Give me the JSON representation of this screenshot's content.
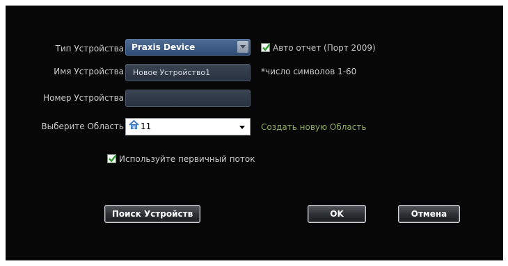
{
  "form": {
    "device_type_label": "Тип Устройства",
    "device_type_value": "Praxis Device",
    "auto_report_label": "Авто отчет (Порт 2009)",
    "auto_report_checked": true,
    "device_name_label": "Имя Устройства",
    "device_name_value": "Новое Устройство1",
    "device_name_hint": "*число символов 1-60",
    "device_number_label": "Номер Устройства",
    "device_number_value": "",
    "area_label": "Выберите Область",
    "area_value": "11",
    "create_area_link": "Создать новую Область",
    "primary_stream_label": "Используйте первичный поток",
    "primary_stream_checked": true
  },
  "buttons": {
    "search_label": "Поиск Устройств",
    "ok_label": "OK",
    "cancel_label": "Отмена"
  },
  "colors": {
    "background": "#070708",
    "link": "#8faa5a",
    "check": "#2e9e2e"
  },
  "icons": {
    "area_icon": "house-icon",
    "dropdown_icon": "chevron-down-icon",
    "check_icon": "checkmark-icon"
  }
}
